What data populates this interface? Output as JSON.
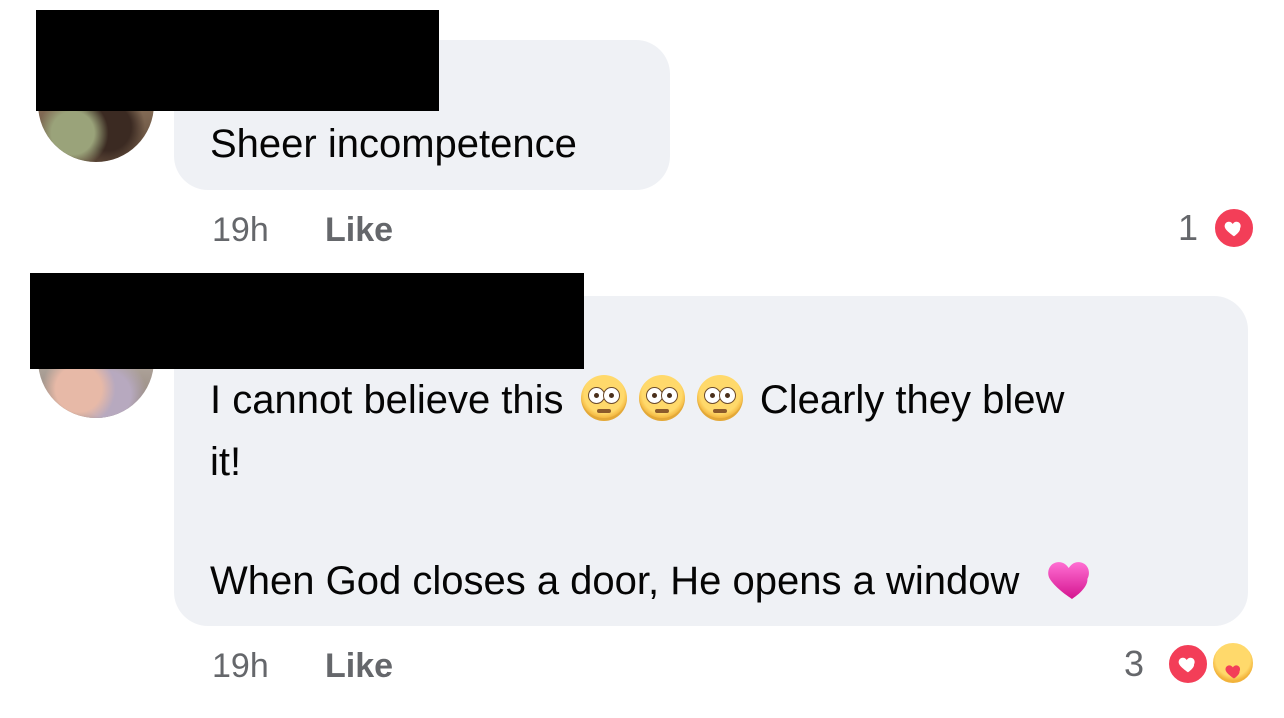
{
  "comments": [
    {
      "text": "Sheer incompetence",
      "time": "19h",
      "like_label": "Like",
      "reaction_count": "1",
      "reactions": [
        "love"
      ]
    },
    {
      "line1_before_emoji": "I cannot believe this",
      "emoji_name": "flushed-face",
      "emoji_count": 3,
      "line1_after_emoji": "Clearly they blew",
      "line2": "it!",
      "line3": "When God closes a door, He opens a window",
      "trailing_emoji": "pink-heart",
      "time": "19h",
      "like_label": "Like",
      "reaction_count": "3",
      "reactions": [
        "love",
        "care"
      ]
    }
  ]
}
